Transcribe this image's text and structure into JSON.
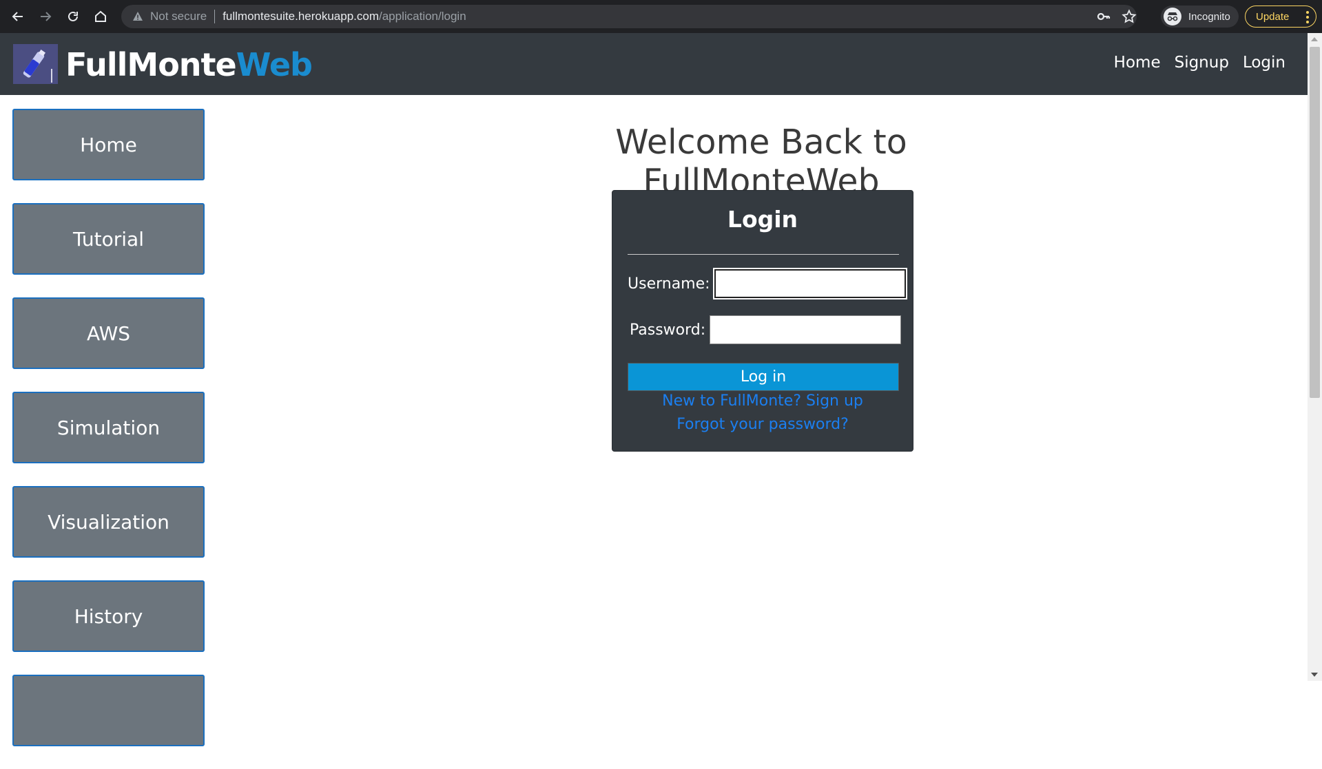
{
  "browser": {
    "security_label": "Not secure",
    "url_host": "fullmontesuite.herokuapp.com",
    "url_path": "/application/login",
    "profile_label": "Incognito",
    "update_label": "Update"
  },
  "navbar": {
    "brand_main": "FullMonte",
    "brand_accent": "Web",
    "links": [
      "Home",
      "Signup",
      "Login"
    ]
  },
  "sidebar": {
    "items": [
      "Home",
      "Tutorial",
      "AWS",
      "Simulation",
      "Visualization",
      "History"
    ]
  },
  "main": {
    "heading": "Welcome Back to FullMonteWeb"
  },
  "login": {
    "title": "Login",
    "username_label": "Username:",
    "username_value": "",
    "password_label": "Password:",
    "password_value": "",
    "submit_label": "Log in",
    "signup_link": "New to FullMonte? Sign up",
    "forgot_link": "Forgot your password?"
  },
  "colors": {
    "navbar_bg": "#343a40",
    "brand_accent": "#1a8ccf",
    "sidebar_button": "#6c757d",
    "login_button": "#0a95d6",
    "link": "#1b7ff0"
  }
}
